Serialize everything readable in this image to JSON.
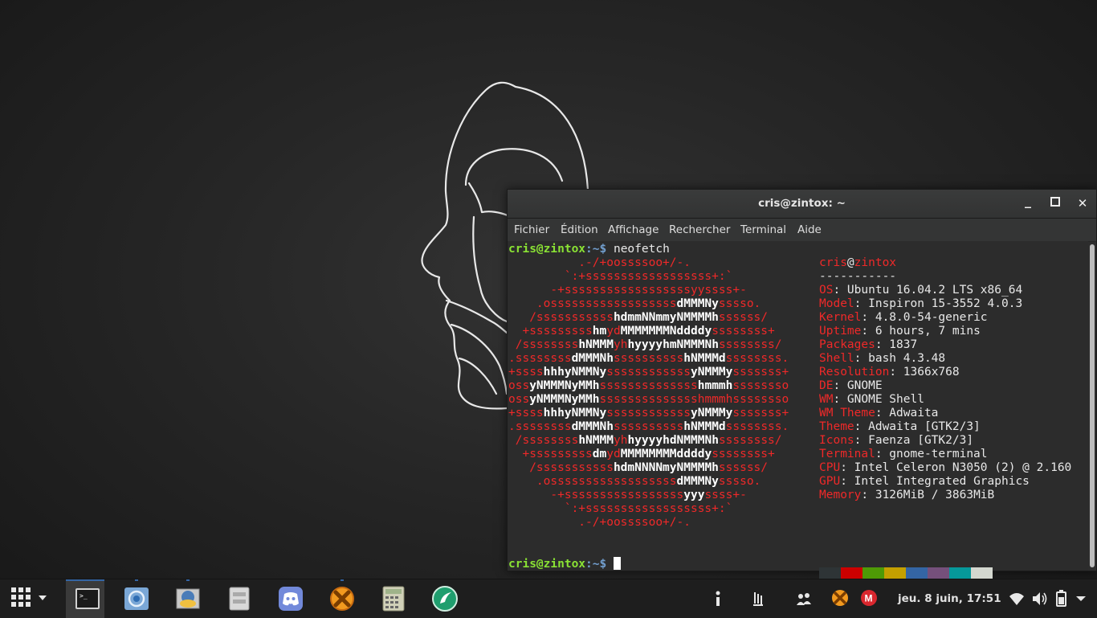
{
  "window": {
    "title": "cris@zintox: ~",
    "menu": [
      "Fichier",
      "Édition",
      "Affichage",
      "Rechercher",
      "Terminal",
      "Aide"
    ]
  },
  "terminal": {
    "prompt_user": "cris@zintox",
    "prompt_path": ":~$",
    "command": " neofetch",
    "logo": [
      [
        [
          "r",
          "          .-/+oossssoo+/-."
        ]
      ],
      [
        [
          "r",
          "        `:+ssssssssssssssssss+:`"
        ]
      ],
      [
        [
          "r",
          "      -+ssssssssssssssssssyyssss+-"
        ]
      ],
      [
        [
          "r",
          "    .ossssssssssssssssss"
        ],
        [
          "w",
          "dMMMNy"
        ],
        [
          "r",
          "sssso."
        ]
      ],
      [
        [
          "r",
          "   /sssssssssss"
        ],
        [
          "w",
          "hdmmNNmmyNMMMMh"
        ],
        [
          "r",
          "ssssss/"
        ]
      ],
      [
        [
          "r",
          "  +sssssssss"
        ],
        [
          "w",
          "hm"
        ],
        [
          "r",
          "yd"
        ],
        [
          "w",
          "MMMMMMMNddddy"
        ],
        [
          "r",
          "ssssssss+"
        ]
      ],
      [
        [
          "r",
          " /ssssssss"
        ],
        [
          "w",
          "hNMMM"
        ],
        [
          "r",
          "yh"
        ],
        [
          "w",
          "hyyyyhmNMMMNh"
        ],
        [
          "r",
          "ssssssss/"
        ]
      ],
      [
        [
          "r",
          ".ssssssss"
        ],
        [
          "w",
          "dMMMNh"
        ],
        [
          "r",
          "ssssssssss"
        ],
        [
          "w",
          "hNMMMd"
        ],
        [
          "r",
          "ssssssss."
        ]
      ],
      [
        [
          "r",
          "+ssss"
        ],
        [
          "w",
          "hhhyNMMNy"
        ],
        [
          "r",
          "ssssssssssss"
        ],
        [
          "w",
          "yNMMMy"
        ],
        [
          "r",
          "sssssss+"
        ]
      ],
      [
        [
          "r",
          "oss"
        ],
        [
          "w",
          "yNMMMNyMMh"
        ],
        [
          "r",
          "ssssssssssssss"
        ],
        [
          "w",
          "hmmmh"
        ],
        [
          "r",
          "ssssssso"
        ]
      ],
      [
        [
          "r",
          "oss"
        ],
        [
          "w",
          "yNMMMNyMMh"
        ],
        [
          "r",
          "sssssssssssssshmmmhssssssso"
        ]
      ],
      [
        [
          "r",
          "+ssss"
        ],
        [
          "w",
          "hhhyNMMNy"
        ],
        [
          "r",
          "ssssssssssss"
        ],
        [
          "w",
          "yNMMMy"
        ],
        [
          "r",
          "sssssss+"
        ]
      ],
      [
        [
          "r",
          ".ssssssss"
        ],
        [
          "w",
          "dMMMNh"
        ],
        [
          "r",
          "ssssssssss"
        ],
        [
          "w",
          "hNMMMd"
        ],
        [
          "r",
          "ssssssss."
        ]
      ],
      [
        [
          "r",
          " /ssssssss"
        ],
        [
          "w",
          "hNMMM"
        ],
        [
          "r",
          "yh"
        ],
        [
          "w",
          "hyyyyhdNMMMNh"
        ],
        [
          "r",
          "ssssssss/"
        ]
      ],
      [
        [
          "r",
          "  +sssssssss"
        ],
        [
          "w",
          "dm"
        ],
        [
          "r",
          "yd"
        ],
        [
          "w",
          "MMMMMMMMddddy"
        ],
        [
          "r",
          "ssssssss+"
        ]
      ],
      [
        [
          "r",
          "   /sssssssssss"
        ],
        [
          "w",
          "hdmNNNNmyNMMMMh"
        ],
        [
          "r",
          "ssssss/"
        ]
      ],
      [
        [
          "r",
          "    .ossssssssssssssssss"
        ],
        [
          "w",
          "dMMMNy"
        ],
        [
          "r",
          "sssso."
        ]
      ],
      [
        [
          "r",
          "      -+sssssssssssssssss"
        ],
        [
          "w",
          "yyy"
        ],
        [
          "r",
          "ssss+-"
        ]
      ],
      [
        [
          "r",
          "        `:+ssssssssssssssssss+:`"
        ]
      ],
      [
        [
          "r",
          "          .-/+oossssoo+/-."
        ]
      ]
    ],
    "info_header_user": "cris",
    "info_header_at": "@",
    "info_header_host": "zintox",
    "info_separator": "-----------",
    "info": [
      {
        "label": "OS",
        "value": ": Ubuntu 16.04.2 LTS x86_64"
      },
      {
        "label": "Model",
        "value": ": Inspiron 15-3552 4.0.3"
      },
      {
        "label": "Kernel",
        "value": ": 4.8.0-54-generic"
      },
      {
        "label": "Uptime",
        "value": ": 6 hours, 7 mins"
      },
      {
        "label": "Packages",
        "value": ": 1837"
      },
      {
        "label": "Shell",
        "value": ": bash 4.3.48"
      },
      {
        "label": "Resolution",
        "value": ": 1366x768"
      },
      {
        "label": "DE",
        "value": ": GNOME"
      },
      {
        "label": "WM",
        "value": ": GNOME Shell"
      },
      {
        "label": "WM Theme",
        "value": ": Adwaita"
      },
      {
        "label": "Theme",
        "value": ": Adwaita [GTK2/3]"
      },
      {
        "label": "Icons",
        "value": ": Faenza [GTK2/3]"
      },
      {
        "label": "Terminal",
        "value": ": gnome-terminal"
      },
      {
        "label": "CPU",
        "value": ": Intel Celeron N3050 (2) @ 2.160"
      },
      {
        "label": "GPU",
        "value": ": Intel Integrated Graphics"
      },
      {
        "label": "Memory",
        "value": ": 3126MiB / 3863MiB"
      }
    ],
    "palette": [
      "#2e3436",
      "#cc0000",
      "#4e9a06",
      "#c4a000",
      "#3465a4",
      "#75507b",
      "#06989a",
      "#d3d7cf"
    ]
  },
  "taskbar": {
    "apps": [
      {
        "name": "app-menu-grid-icon"
      },
      {
        "name": "terminal-icon",
        "active": true
      },
      {
        "name": "browser-icon"
      },
      {
        "name": "thunderbird-icon"
      },
      {
        "name": "files-icon"
      },
      {
        "name": "discord-icon"
      },
      {
        "name": "xtreme-download-icon"
      },
      {
        "name": "calculator-icon"
      },
      {
        "name": "green-circle-app-icon"
      }
    ],
    "clock": "jeu.  8 juin, 17:51",
    "accent": "#3465a4"
  }
}
